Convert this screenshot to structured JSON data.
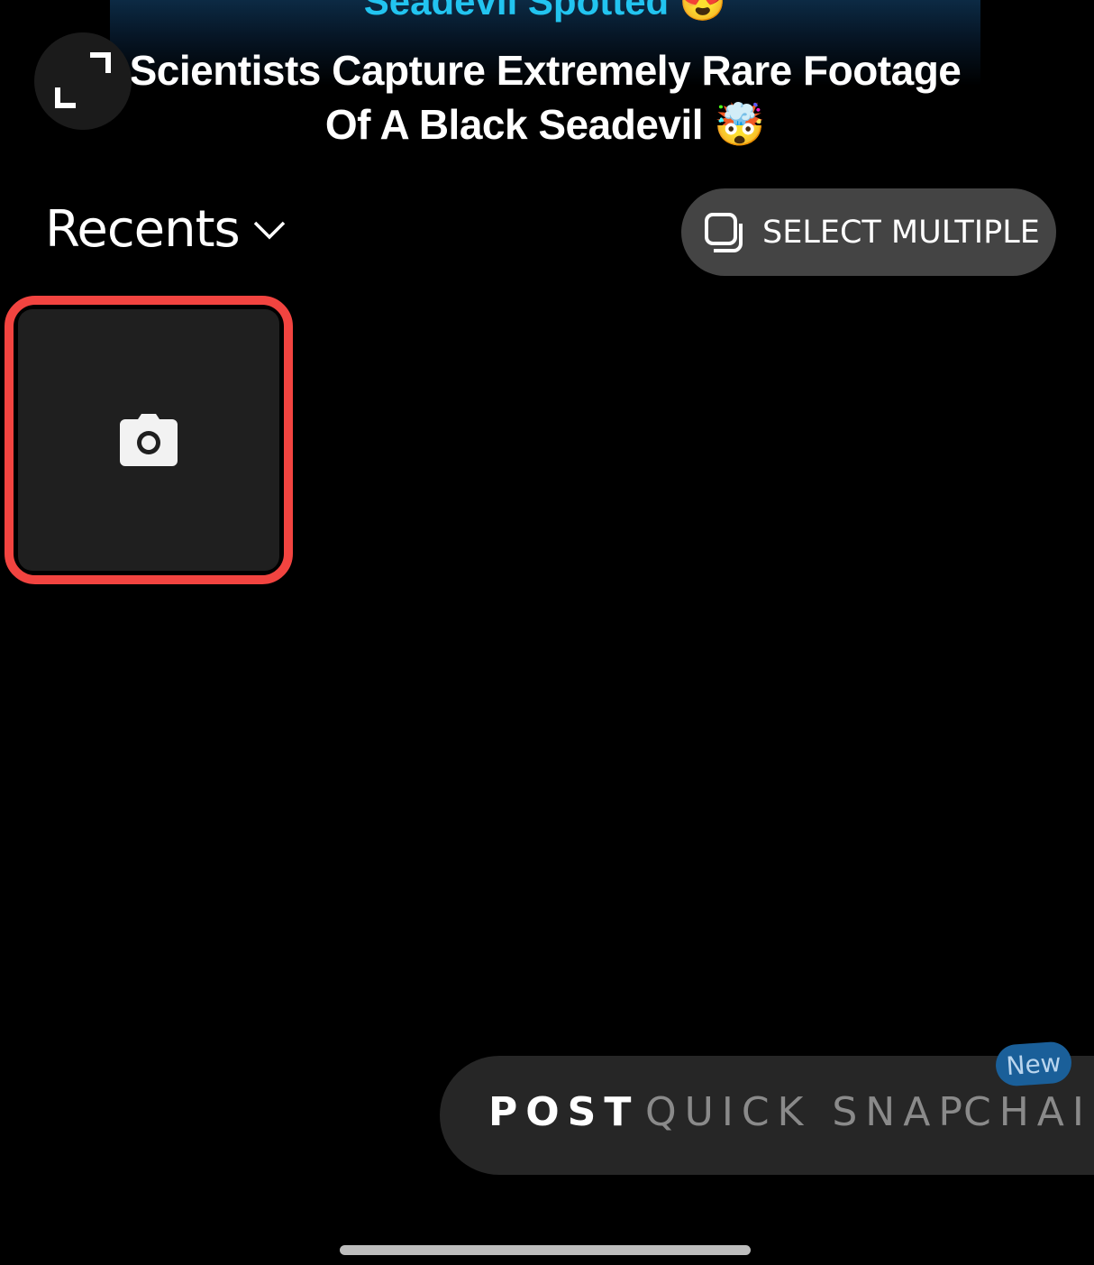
{
  "banner": {
    "kicker": "Seadevil Spotted 😍",
    "headline": "Scientists Capture Extremely Rare Footage Of A Black Seadevil 🤯"
  },
  "gallery": {
    "album_label": "Recents",
    "select_multiple_label": "SELECT MULTIPLE"
  },
  "modes": {
    "items": [
      "POST",
      "QUICK SNAP",
      "CHAIN"
    ],
    "new_badge": "New"
  },
  "colors": {
    "highlight": "#f24440",
    "badge": "#1a5f99"
  }
}
